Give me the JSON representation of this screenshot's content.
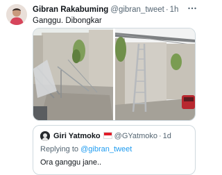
{
  "tweet": {
    "author_name": "Gibran Rakabuming",
    "author_handle": "@gibran_tweet",
    "separator": "·",
    "time": "1h",
    "text": "Ganggu. Dibongkar",
    "more_icon": "more-horizontal-icon",
    "avatar_icon": "profile-avatar",
    "media": [
      {
        "name": "photo-collapsed-canopy"
      },
      {
        "name": "photo-ladder-garage"
      }
    ]
  },
  "quote": {
    "author_name": "Giri Yatmoko",
    "flag_icon": "indonesia-flag-icon",
    "author_handle": "@GYatmoko",
    "separator": "·",
    "time": "1d",
    "replying_prefix": "Replying to",
    "replying_to": "@gibran_tweet",
    "text": "Ora ganggu jane.."
  },
  "colors": {
    "text": "#0f1419",
    "secondary": "#536471",
    "link": "#1d9bf0",
    "border": "#cfd9de"
  }
}
